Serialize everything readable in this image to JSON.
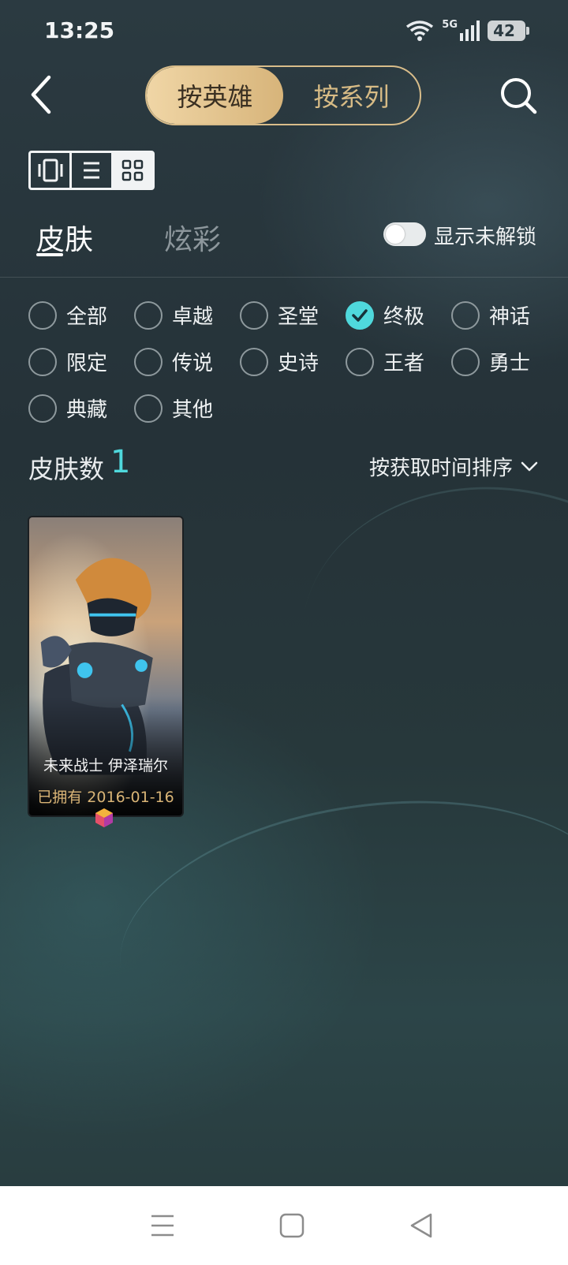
{
  "status_bar": {
    "time": "13:25",
    "network": "5G",
    "battery": "42"
  },
  "header": {
    "segments": [
      {
        "label": "按英雄",
        "active": true
      },
      {
        "label": "按系列",
        "active": false
      }
    ]
  },
  "view_modes": [
    "card-view-icon",
    "list-view-icon",
    "grid-view-icon"
  ],
  "tabs": [
    {
      "label": "皮肤",
      "active": true
    },
    {
      "label": "炫彩",
      "active": false
    }
  ],
  "unlock_toggle": {
    "label": "显示未解锁",
    "on": false
  },
  "filters": [
    {
      "label": "全部",
      "checked": false
    },
    {
      "label": "卓越",
      "checked": false
    },
    {
      "label": "圣堂",
      "checked": false
    },
    {
      "label": "终极",
      "checked": true
    },
    {
      "label": "神话",
      "checked": false
    },
    {
      "label": "限定",
      "checked": false
    },
    {
      "label": "传说",
      "checked": false
    },
    {
      "label": "史诗",
      "checked": false
    },
    {
      "label": "王者",
      "checked": false
    },
    {
      "label": "勇士",
      "checked": false
    },
    {
      "label": "典藏",
      "checked": false
    },
    {
      "label": "其他",
      "checked": false
    }
  ],
  "skin_count": {
    "label": "皮肤数",
    "value": "1"
  },
  "sort": {
    "label": "按获取时间排序"
  },
  "skins": [
    {
      "name": "未来战士 伊泽瑞尔",
      "owned": "已拥有 2016-01-16"
    }
  ],
  "colors": {
    "accent": "#4fd8dc",
    "gold": "#d9b476"
  }
}
